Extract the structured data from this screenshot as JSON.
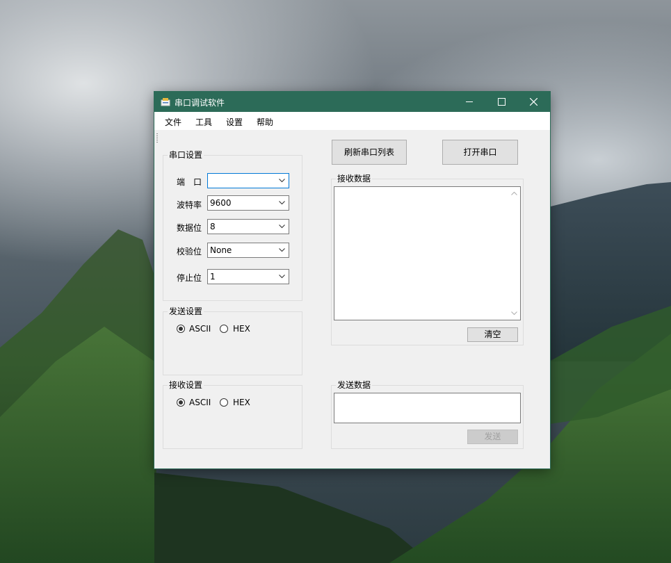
{
  "window": {
    "title": "串口调试软件",
    "accent": "#2c6b58"
  },
  "menu": [
    "文件",
    "工具",
    "设置",
    "帮助"
  ],
  "port_settings": {
    "title": "串口设置",
    "fields": [
      {
        "label": "端　口",
        "value": ""
      },
      {
        "label": "波特率",
        "value": "9600"
      },
      {
        "label": "数据位",
        "value": "8"
      },
      {
        "label": "校验位",
        "value": "None"
      },
      {
        "label": "停止位",
        "value": "1"
      }
    ]
  },
  "send_settings": {
    "title": "发送设置",
    "options": [
      "ASCII",
      "HEX"
    ],
    "selected": "ASCII"
  },
  "receive_settings": {
    "title": "接收设置",
    "options": [
      "ASCII",
      "HEX"
    ],
    "selected": "ASCII"
  },
  "buttons": {
    "refresh": "刷新串口列表",
    "open": "打开串口",
    "clear": "清空",
    "send": "发送"
  },
  "receive_data": {
    "title": "接收数据",
    "content": ""
  },
  "send_data": {
    "title": "发送数据",
    "content": ""
  }
}
